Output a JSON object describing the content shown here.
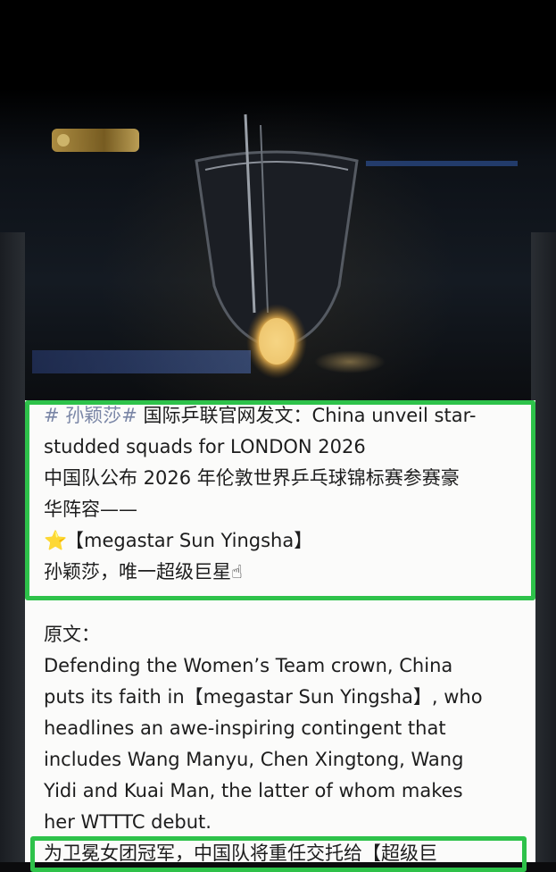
{
  "video": {
    "ticker_text": "",
    "icons": [
      "broadcast-logo-icon",
      "trophy-icon"
    ]
  },
  "post": {
    "hashtag": "# 孙颖莎#",
    "headline_1": " 国际乒联官网发文：China unveil star-",
    "headline_2": "studded squads for LONDON 2026",
    "cn_line_1": "中国队公布 2026 年伦敦世界乒乓球锦标赛参赛豪",
    "cn_line_2": "华阵容——",
    "star_icon": "⭐",
    "megastar": "【megastar Sun Yingsha】",
    "cn_line_3": "孙颖莎，唯一超级巨星",
    "hand_icon": "☝"
  },
  "original": {
    "label": "原文：",
    "lines": [
      "Defending the Women’s Team crown, China",
      "puts its faith in【megastar Sun Yingsha】, who",
      "headlines an awe-inspiring contingent that",
      "includes Wang Manyu, Chen Xingtong, Wang",
      "Yidi and Kuai Man, the latter of whom makes",
      "her WTTTC debut."
    ]
  },
  "translation": {
    "line_1": "为卫冕女团冠军，中国队将重任交托给【超级巨"
  },
  "colors": {
    "highlight_border": "#2ec24a",
    "hashtag": "#7a86a6",
    "text": "#1d1d1d",
    "card_bg": "#fbfbfa"
  }
}
